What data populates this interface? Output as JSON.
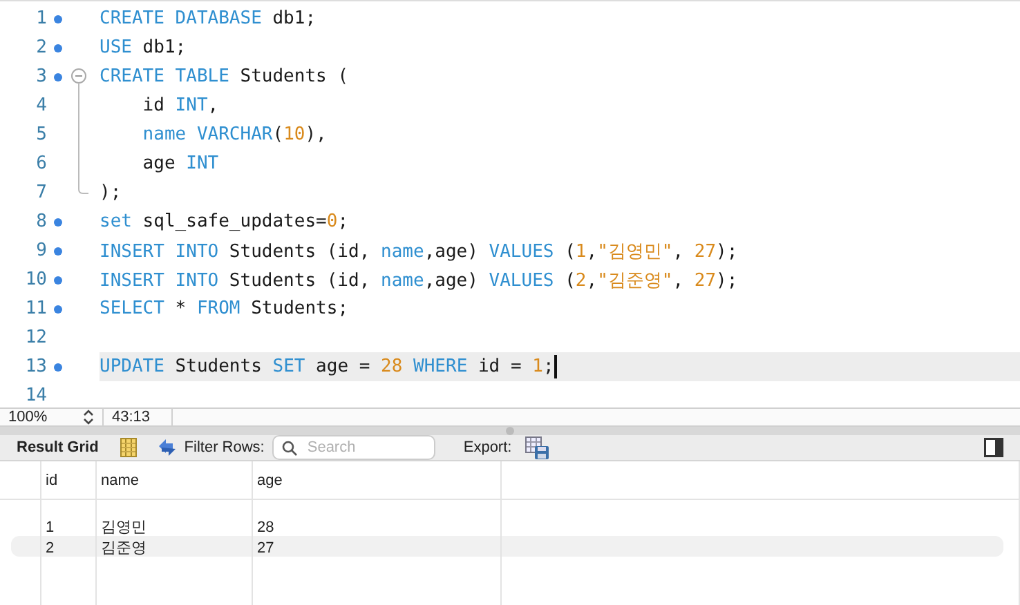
{
  "editor": {
    "lines": [
      {
        "number": "1",
        "marker": true,
        "kind": "plain",
        "tokens": [
          {
            "kind": "keyword",
            "text": "CREATE DATABASE"
          },
          {
            "kind": "text",
            "text": " db1;"
          }
        ]
      },
      {
        "number": "2",
        "marker": true,
        "kind": "plain",
        "tokens": [
          {
            "kind": "keyword",
            "text": "USE"
          },
          {
            "kind": "text",
            "text": " db1;"
          }
        ]
      },
      {
        "number": "3",
        "marker": true,
        "kind": "fold-start",
        "tokens": [
          {
            "kind": "keyword",
            "text": "CREATE TABLE"
          },
          {
            "kind": "text",
            "text": " Students ("
          }
        ]
      },
      {
        "number": "4",
        "marker": false,
        "kind": "fold-inside",
        "tokens": [
          {
            "kind": "text",
            "text": "    id "
          },
          {
            "kind": "keyword",
            "text": "INT"
          },
          {
            "kind": "text",
            "text": ","
          }
        ]
      },
      {
        "number": "5",
        "marker": false,
        "kind": "fold-inside",
        "tokens": [
          {
            "kind": "keyword",
            "text": "    name VARCHAR"
          },
          {
            "kind": "text",
            "text": "("
          },
          {
            "kind": "number",
            "text": "10"
          },
          {
            "kind": "text",
            "text": "),"
          }
        ]
      },
      {
        "number": "6",
        "marker": false,
        "kind": "fold-inside",
        "tokens": [
          {
            "kind": "text",
            "text": "    age "
          },
          {
            "kind": "keyword",
            "text": "INT"
          }
        ]
      },
      {
        "number": "7",
        "marker": false,
        "kind": "fold-end",
        "tokens": [
          {
            "kind": "text",
            "text": ");"
          }
        ]
      },
      {
        "number": "8",
        "marker": true,
        "kind": "plain",
        "tokens": [
          {
            "kind": "keyword",
            "text": "set"
          },
          {
            "kind": "text",
            "text": " sql_safe_updates="
          },
          {
            "kind": "number",
            "text": "0"
          },
          {
            "kind": "text",
            "text": ";"
          }
        ]
      },
      {
        "number": "9",
        "marker": true,
        "kind": "plain",
        "tokens": [
          {
            "kind": "keyword",
            "text": "INSERT INTO"
          },
          {
            "kind": "text",
            "text": " Students (id, "
          },
          {
            "kind": "keyword",
            "text": "name"
          },
          {
            "kind": "text",
            "text": ",age) "
          },
          {
            "kind": "keyword",
            "text": "VALUES"
          },
          {
            "kind": "text",
            "text": " ("
          },
          {
            "kind": "number",
            "text": "1"
          },
          {
            "kind": "text",
            "text": ","
          },
          {
            "kind": "string",
            "text": "\"김영민\""
          },
          {
            "kind": "text",
            "text": ", "
          },
          {
            "kind": "number",
            "text": "27"
          },
          {
            "kind": "text",
            "text": ");"
          }
        ]
      },
      {
        "number": "10",
        "marker": true,
        "kind": "plain",
        "tokens": [
          {
            "kind": "keyword",
            "text": "INSERT INTO"
          },
          {
            "kind": "text",
            "text": " Students (id, "
          },
          {
            "kind": "keyword",
            "text": "name"
          },
          {
            "kind": "text",
            "text": ",age) "
          },
          {
            "kind": "keyword",
            "text": "VALUES"
          },
          {
            "kind": "text",
            "text": " ("
          },
          {
            "kind": "number",
            "text": "2"
          },
          {
            "kind": "text",
            "text": ","
          },
          {
            "kind": "string",
            "text": "\"김준영\""
          },
          {
            "kind": "text",
            "text": ", "
          },
          {
            "kind": "number",
            "text": "27"
          },
          {
            "kind": "text",
            "text": ");"
          }
        ]
      },
      {
        "number": "11",
        "marker": true,
        "kind": "plain",
        "tokens": [
          {
            "kind": "keyword",
            "text": "SELECT"
          },
          {
            "kind": "text",
            "text": " * "
          },
          {
            "kind": "keyword",
            "text": "FROM"
          },
          {
            "kind": "text",
            "text": " Students;"
          }
        ]
      },
      {
        "number": "12",
        "marker": false,
        "kind": "plain"
      },
      {
        "number": "13",
        "marker": true,
        "kind": "plain",
        "current": true,
        "tokens": [
          {
            "kind": "keyword",
            "text": "UPDATE"
          },
          {
            "kind": "text",
            "text": " Students "
          },
          {
            "kind": "keyword",
            "text": "SET"
          },
          {
            "kind": "text",
            "text": " age = "
          },
          {
            "kind": "number",
            "text": "28"
          },
          {
            "kind": "keyword",
            "text": " WHERE"
          },
          {
            "kind": "text",
            "text": " id = "
          },
          {
            "kind": "number",
            "text": "1"
          },
          {
            "kind": "text",
            "text": ";"
          }
        ]
      },
      {
        "number": "14",
        "marker": false,
        "kind": "plain"
      }
    ]
  },
  "status_bar": {
    "zoom": "100%",
    "position": "43:13"
  },
  "result_toolbar": {
    "title": "Result Grid",
    "filter_label": "Filter Rows:",
    "search": {
      "placeholder": "Search"
    },
    "export_label": "Export:"
  },
  "result_grid": {
    "columns": [
      "id",
      "name",
      "age"
    ],
    "rows": [
      [
        "1",
        "김영민",
        "28"
      ],
      [
        "2",
        "김준영",
        "27"
      ]
    ]
  }
}
